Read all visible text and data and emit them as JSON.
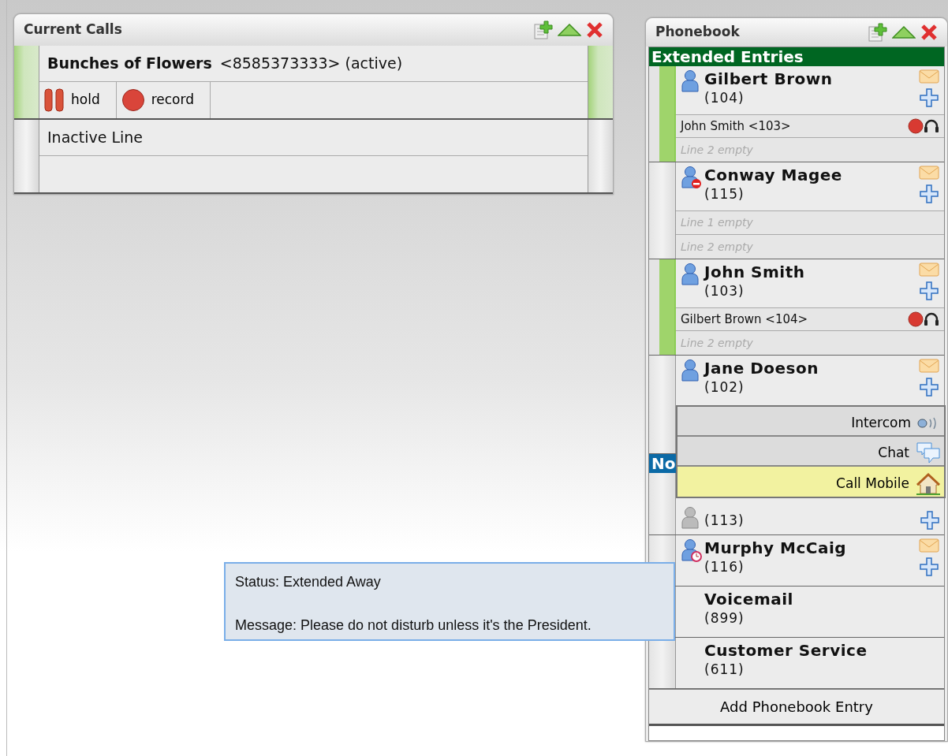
{
  "current_calls": {
    "title": "Current Calls",
    "lines": [
      {
        "kind": "call",
        "name": "Bunches of Flowers",
        "detail": "<8585373333> (active)",
        "active": true,
        "actions": [
          {
            "kind": "hold",
            "label": "hold"
          },
          {
            "kind": "record",
            "label": "record"
          }
        ]
      },
      {
        "kind": "inactive",
        "label": "Inactive Line",
        "active": false
      }
    ]
  },
  "phonebook": {
    "title": "Phonebook",
    "sections": [
      {
        "title": "Extended Entries",
        "color": "#006622",
        "entries": [
          {
            "kind": "available",
            "name": "Gilbert Brown",
            "ext": "(104)",
            "active": true,
            "mail": true,
            "add": true,
            "lines": [
              {
                "kind": "call",
                "text": "John Smith <103>"
              },
              {
                "kind": "empty",
                "text": "Line 2 empty"
              }
            ]
          },
          {
            "kind": "busy",
            "name": "Conway Magee",
            "ext": "(115)",
            "active": false,
            "mail": true,
            "add": true,
            "lines": [
              {
                "kind": "empty",
                "text": "Line 1 empty"
              },
              {
                "kind": "empty",
                "text": "Line 2 empty"
              }
            ]
          },
          {
            "kind": "available",
            "name": "John Smith",
            "ext": "(103)",
            "active": true,
            "mail": true,
            "add": true,
            "lines": [
              {
                "kind": "call",
                "text": "Gilbert Brown <104>"
              },
              {
                "kind": "empty",
                "text": "Line 2 empty"
              }
            ]
          },
          {
            "kind": "available",
            "name": "Jane Doeson",
            "ext": "(102)",
            "active": false,
            "mail": true,
            "add": true,
            "menu": [
              {
                "kind": "intercom",
                "label": "Intercom",
                "selected": false
              },
              {
                "kind": "chat",
                "label": "Chat",
                "selected": false
              },
              {
                "kind": "mobile",
                "label": "Call Mobile",
                "selected": true
              }
            ]
          }
        ]
      },
      {
        "title": "No",
        "color": "#0b6aa6",
        "entries": [
          {
            "kind": "offline",
            "ext": "(113)",
            "active": false,
            "mail": false,
            "add": true
          },
          {
            "kind": "away",
            "name": "Murphy McCaig",
            "ext": "(116)",
            "active": false,
            "mail": true,
            "add": true
          },
          {
            "kind": "plain",
            "name": "Voicemail",
            "ext": "(899)",
            "active": false,
            "mail": false,
            "add": false
          },
          {
            "kind": "plain",
            "name": "Customer Service",
            "ext": "(611)",
            "active": false,
            "mail": false,
            "add": false
          }
        ]
      }
    ],
    "add_button": "Add Phonebook Entry"
  },
  "tooltip": {
    "status": "Status: Extended Away",
    "message": "Message: Please do not disturb unless it's the President."
  }
}
